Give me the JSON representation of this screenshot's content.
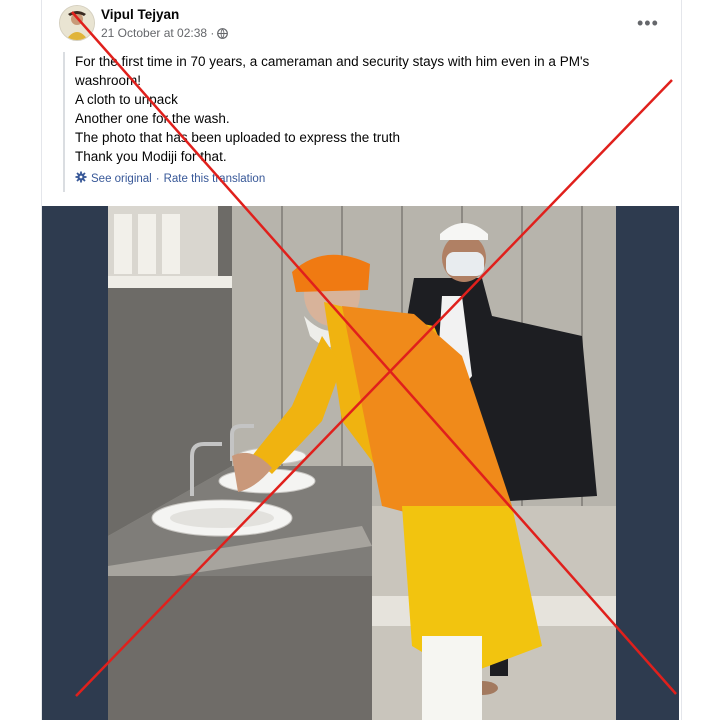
{
  "post": {
    "author": "Vipul Tejyan",
    "timestamp": "21 October at 02:38 ·",
    "more_label": "•••",
    "lines": [
      "For the first time in 70 years, a cameraman and security stays with him even in a PM's",
      "washroom!",
      "A cloth to unpack",
      "Another one for the wash.",
      "The photo that has been uploaded to express the truth",
      "Thank you Modiji for that."
    ],
    "see_original": "See original",
    "separator": "·",
    "rate_translation": "Rate this translation"
  },
  "colors": {
    "link": "#385898",
    "cross": "#e0201c",
    "photo_bg": "#2e3b4f"
  }
}
